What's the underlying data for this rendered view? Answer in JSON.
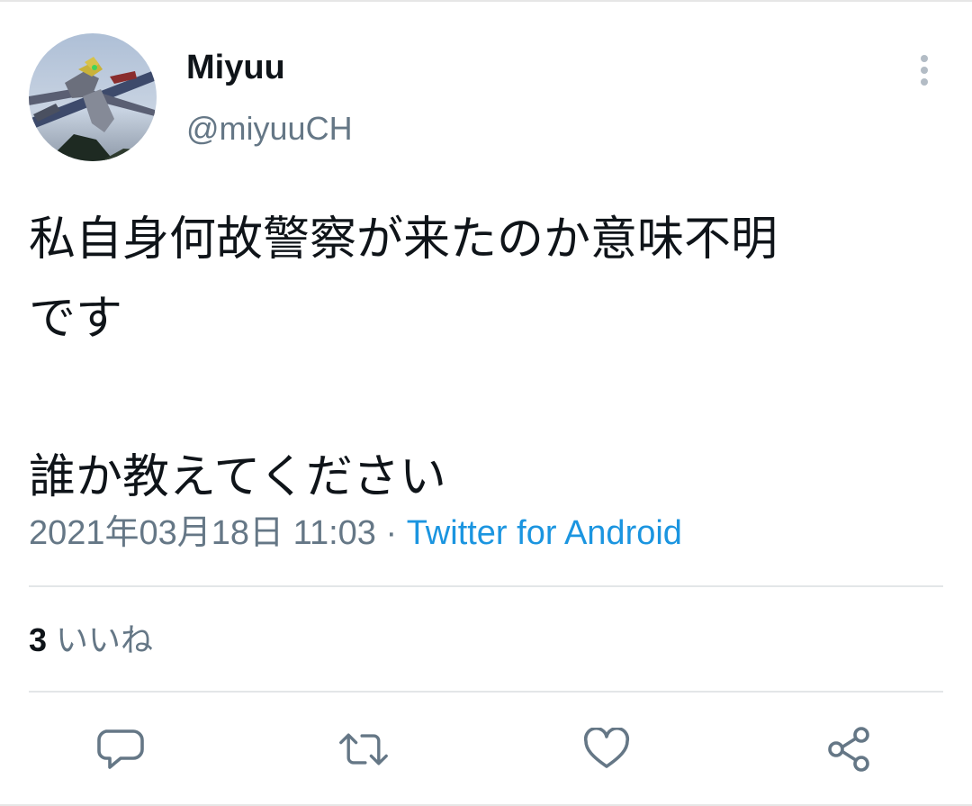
{
  "user": {
    "display_name": "Miyuu",
    "handle": "@miyuuCH",
    "avatar": "anime-mecha-avatar"
  },
  "tweet": {
    "line1": "私自身何故警察が来たのか意味不明",
    "line2": "です",
    "line3": "誰か教えてください"
  },
  "meta": {
    "timestamp": "2021年03月18日 11:03",
    "separator": " · ",
    "source": "Twitter for Android"
  },
  "stats": {
    "likes_count": "3",
    "likes_label": "いいね"
  },
  "icons": {
    "more": "vertical-dots-icon",
    "reply": "speech-bubble-icon",
    "retweet": "retweet-arrows-icon",
    "like": "heart-icon",
    "share": "share-nodes-icon"
  },
  "colors": {
    "text": "#0f1419",
    "secondary": "#657786",
    "link": "#1b95e0",
    "icon": "#657786",
    "divider": "#e3e6e8"
  }
}
